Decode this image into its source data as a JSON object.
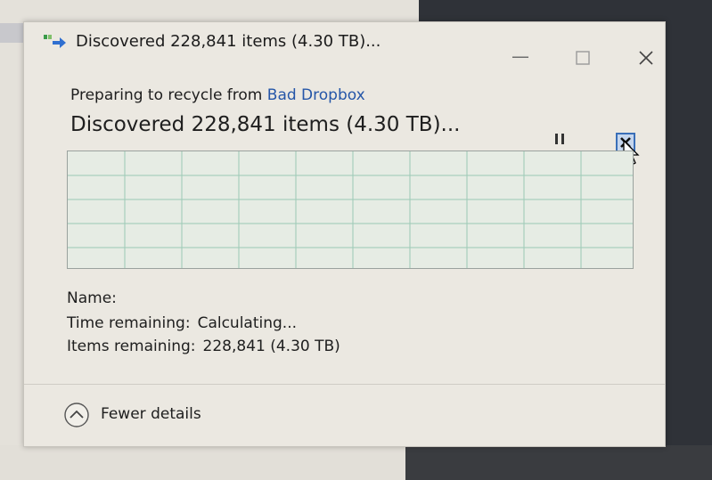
{
  "titlebar": {
    "title": "Discovered 228,841 items (4.30 TB)...",
    "min_glyph": "—",
    "max_glyph": "☐",
    "close_glyph": "✕"
  },
  "operation": {
    "prefix": "Preparing to recycle from ",
    "source": "Bad Dropbox",
    "status": "Discovered 228,841 items (4.30 TB)...",
    "progress": 0
  },
  "details": {
    "name_label": "Name:",
    "name_value": "",
    "time_label": "Time remaining:",
    "time_value": "Calculating...",
    "items_label": "Items remaining:",
    "items_value": "228,841 (4.30 TB)"
  },
  "footer": {
    "fewer_details_label": "Fewer details"
  },
  "colors": {
    "link": "#2556a8",
    "grid_line": "#8fc4ad",
    "dialog_bg": "#ebe8e1"
  },
  "icons": {
    "title_icon": "file-move-icon",
    "pause": "pause-icon",
    "stop": "stop-icon",
    "fewer": "chevron-up-circle-icon"
  }
}
